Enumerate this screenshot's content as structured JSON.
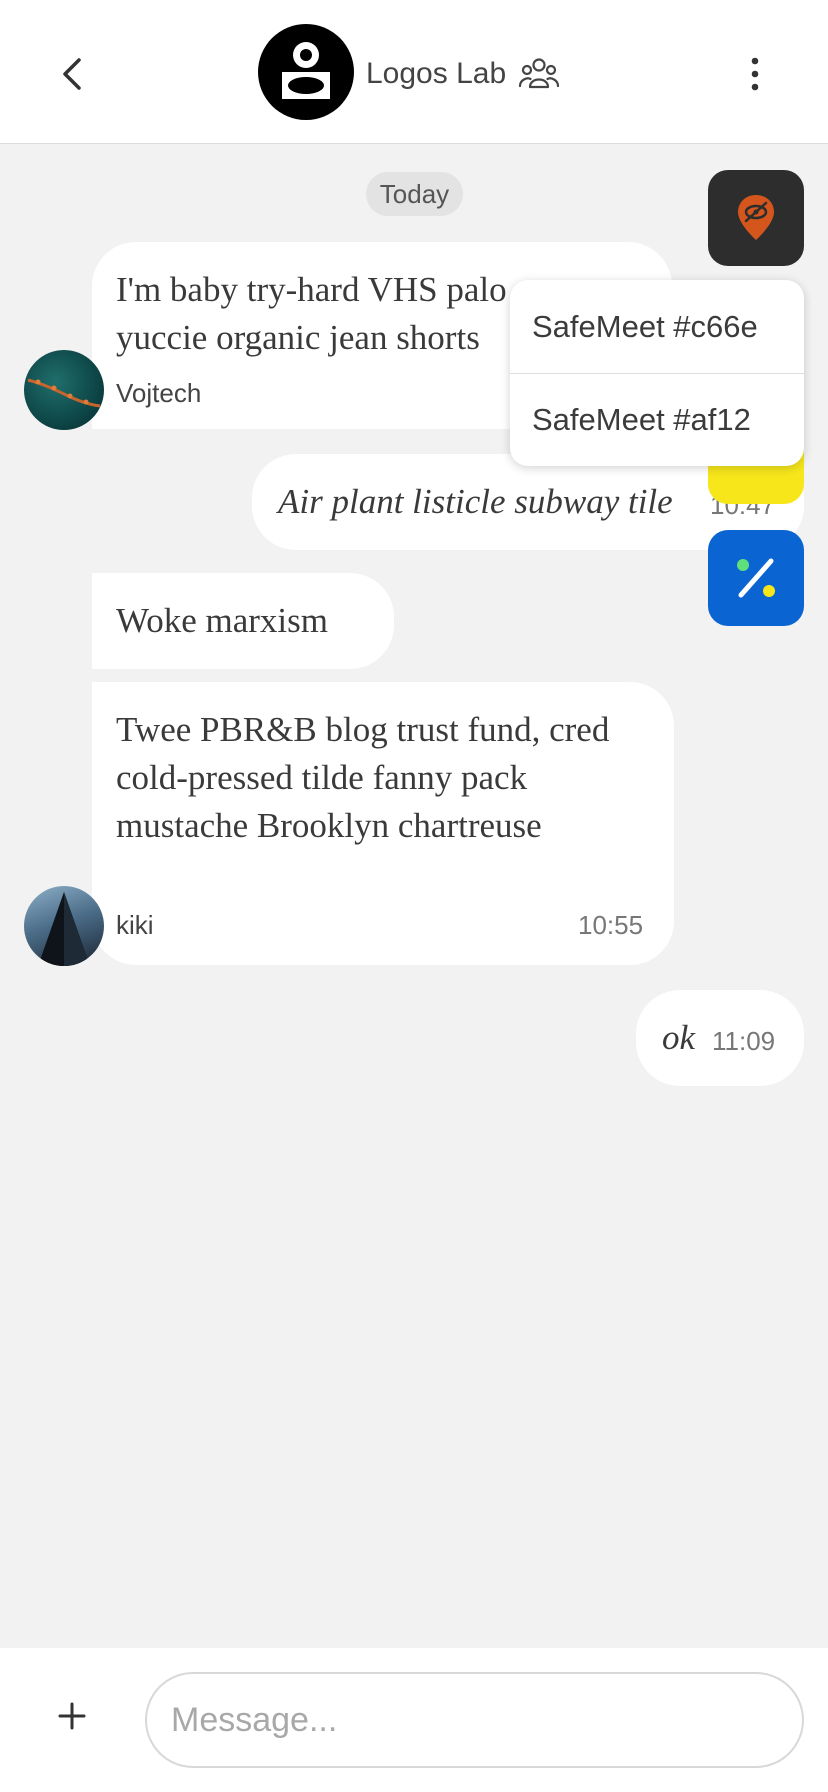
{
  "header": {
    "title": "Logos Lab",
    "back_icon": "chevron-left-icon",
    "group_icon": "group-icon",
    "menu_icon": "more-vertical-icon"
  },
  "date_separator": "Today",
  "messages": [
    {
      "text": "I'm baby try-hard VHS palo santo yuccie organic jean shorts",
      "sender": "Vojtech"
    },
    {
      "text": "Air plant listicle subway tile",
      "time": "10:47"
    },
    {
      "text": "Woke marxism"
    },
    {
      "text": "Twee PBR&B blog trust fund, cred cold-pressed tilde fanny pack mustache Brooklyn chartreuse",
      "sender": "kiki",
      "time": "10:55"
    },
    {
      "text": "ok",
      "time": "11:09"
    }
  ],
  "popup_menu": {
    "items": [
      "SafeMeet #c66e",
      "SafeMeet #af12"
    ]
  },
  "floating_buttons": {
    "dark": "location-hidden-icon",
    "yellow": "yellow-app-icon",
    "blue": "percent-icon"
  },
  "composer": {
    "placeholder": "Message...",
    "add_icon": "plus-icon"
  },
  "colors": {
    "background": "#f2f2f2",
    "fab_dark": "#2d2d2d",
    "fab_yellow": "#f6e61a",
    "fab_blue": "#0a64d2",
    "pin_orange": "#d4561d"
  }
}
